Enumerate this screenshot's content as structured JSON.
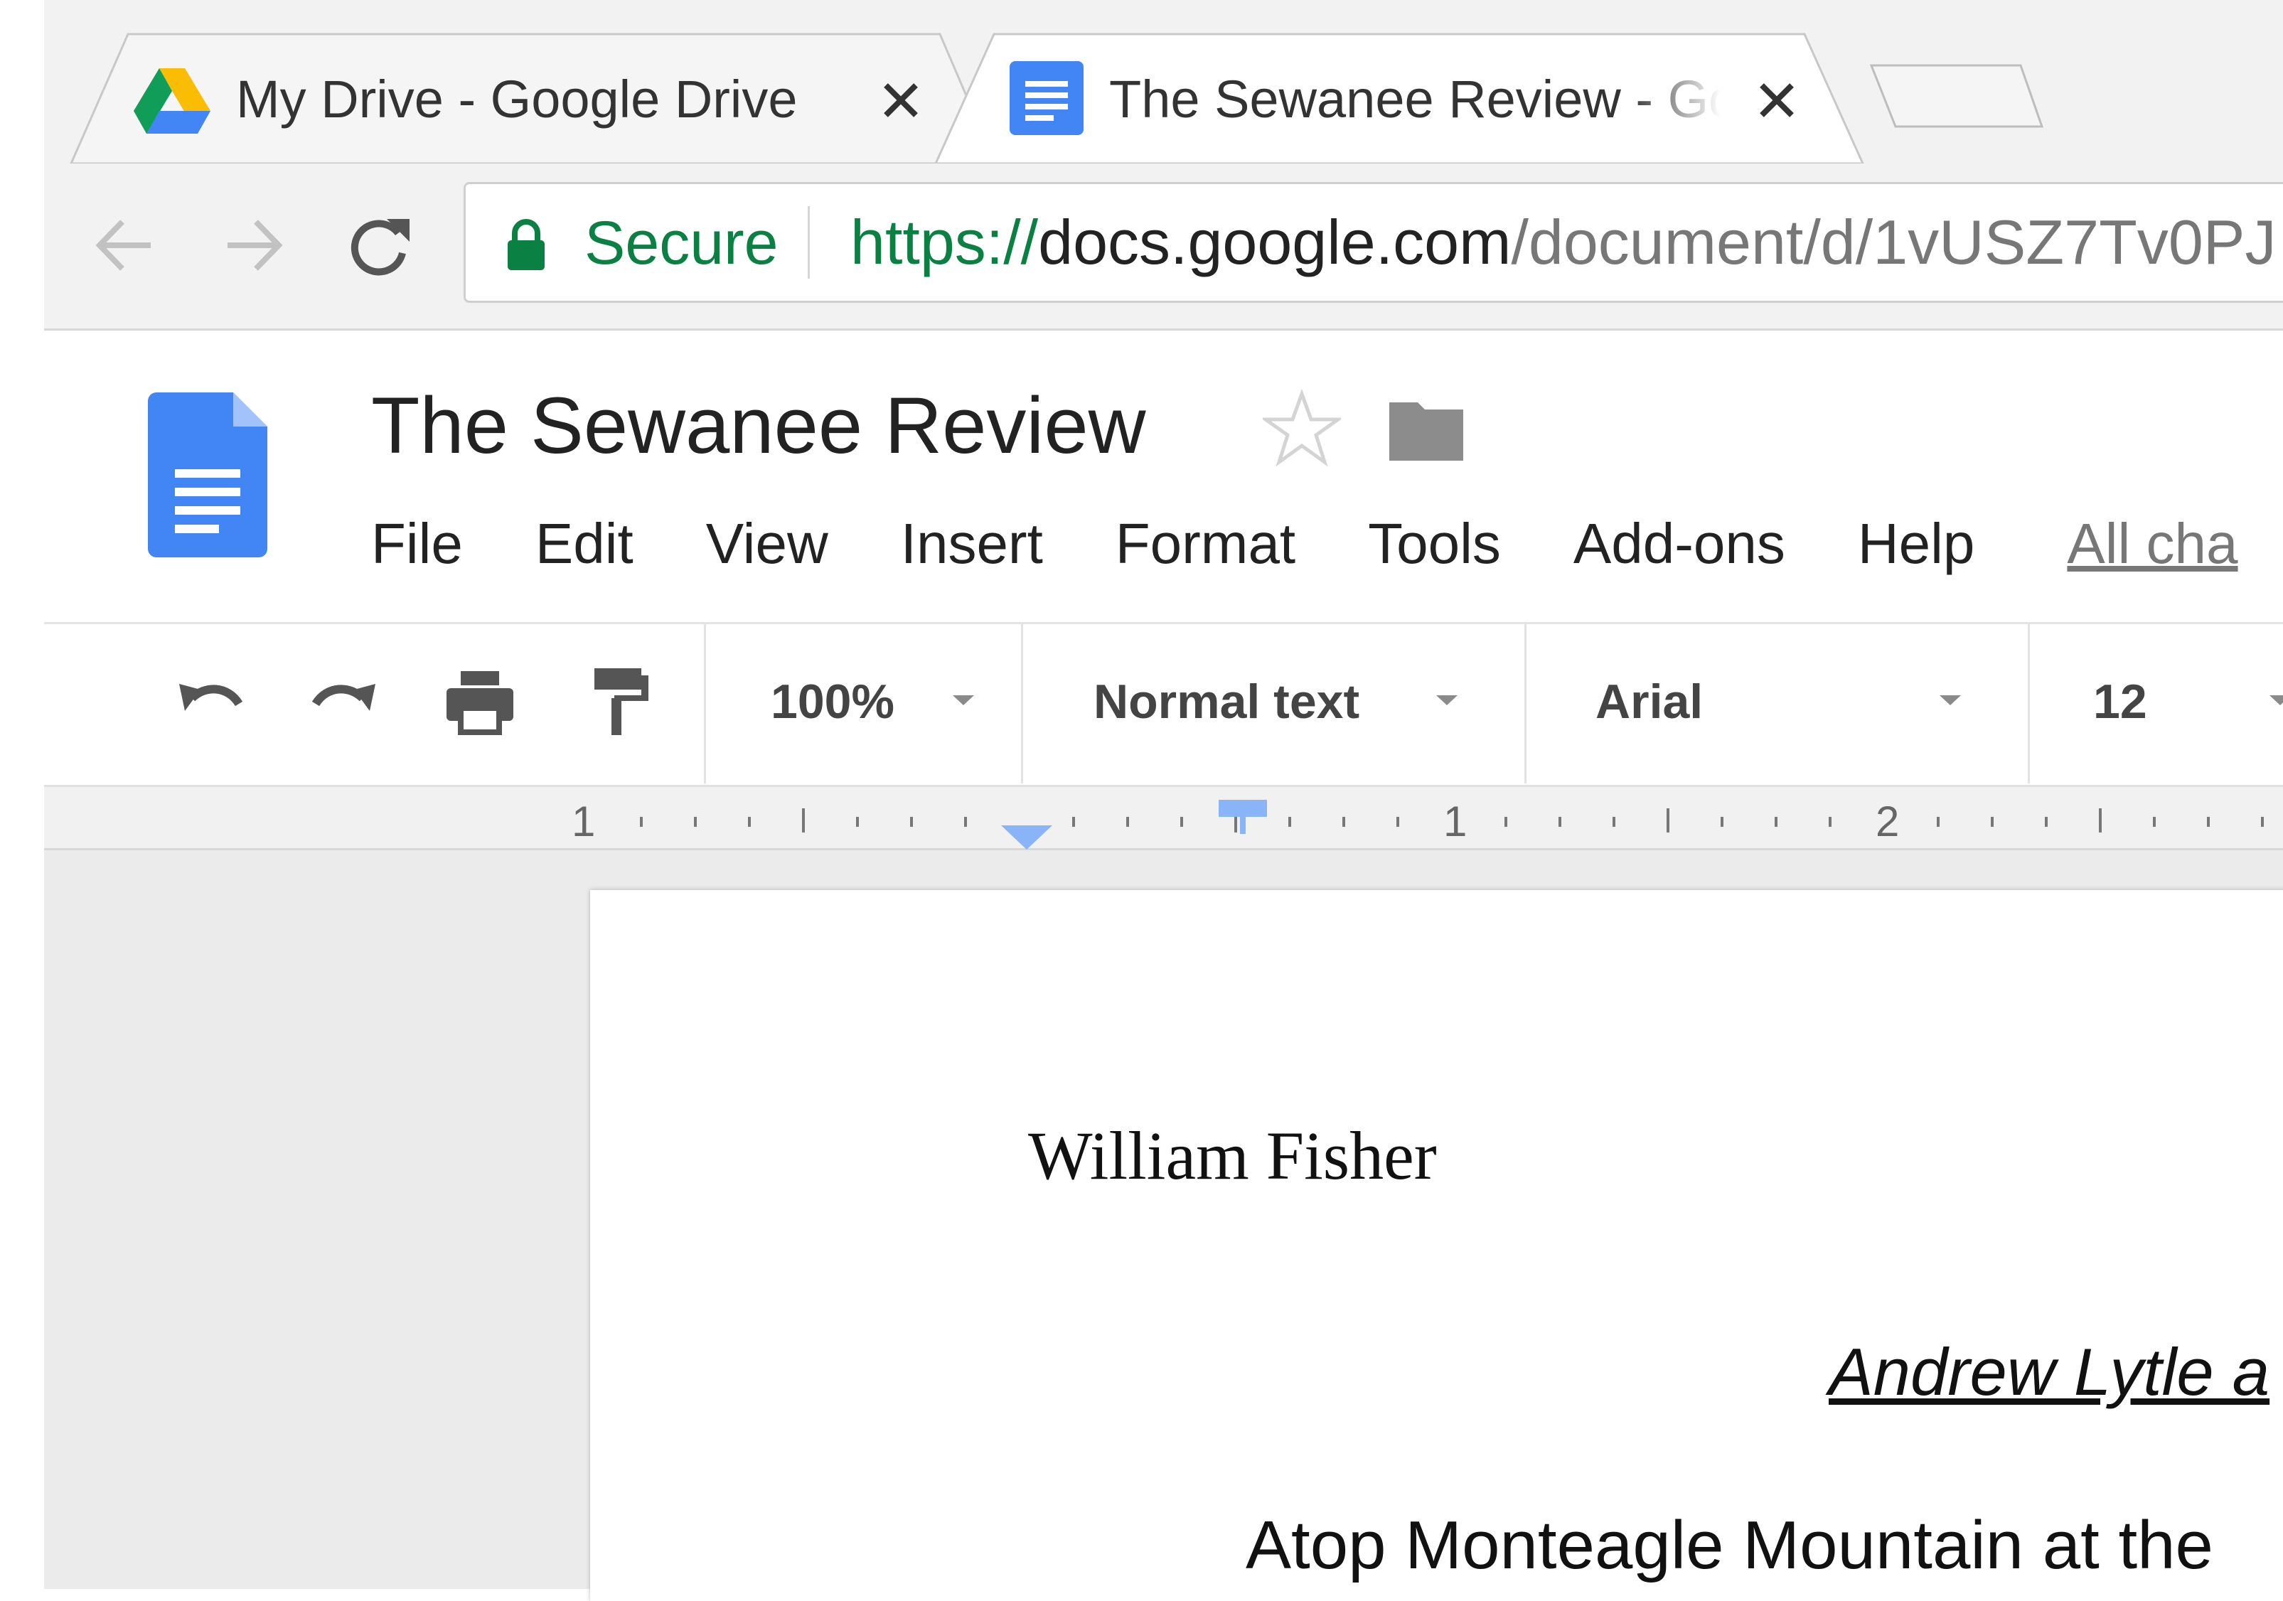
{
  "browser": {
    "tabs": [
      {
        "title": "My Drive - Google Drive",
        "close": "×",
        "icon": "google-drive-icon",
        "active": false
      },
      {
        "title": "The Sewanee Review - Go",
        "close": "×",
        "icon": "google-docs-icon",
        "active": true
      }
    ],
    "address_bar": {
      "secure_label": "Secure",
      "url_scheme": "https://",
      "url_host": "docs.google.com",
      "url_path": "/document/d/1vUSZ7Tv0PJ"
    },
    "nav_icons": [
      "back-arrow-icon",
      "forward-arrow-icon",
      "reload-icon",
      "lock-icon"
    ]
  },
  "docs": {
    "title": "The Sewanee Review",
    "menu": [
      "File",
      "Edit",
      "View",
      "Insert",
      "Format",
      "Tools",
      "Add-ons",
      "Help"
    ],
    "save_status": "All cha",
    "toolbar": {
      "zoom": "100%",
      "style": "Normal text",
      "font": "Arial",
      "font_size": "12"
    },
    "ruler_labels": [
      "1",
      "1",
      "2"
    ]
  },
  "document": {
    "author": "William Fisher",
    "heading": "Andrew Lytle a",
    "body_start": "Atop Monteagle Mountain at the"
  },
  "colors": {
    "secure_green": "#0b8043",
    "docs_blue": "#4285f4",
    "tab_strip": "#f2f2f2",
    "canvas_gray": "#ebebeb"
  }
}
